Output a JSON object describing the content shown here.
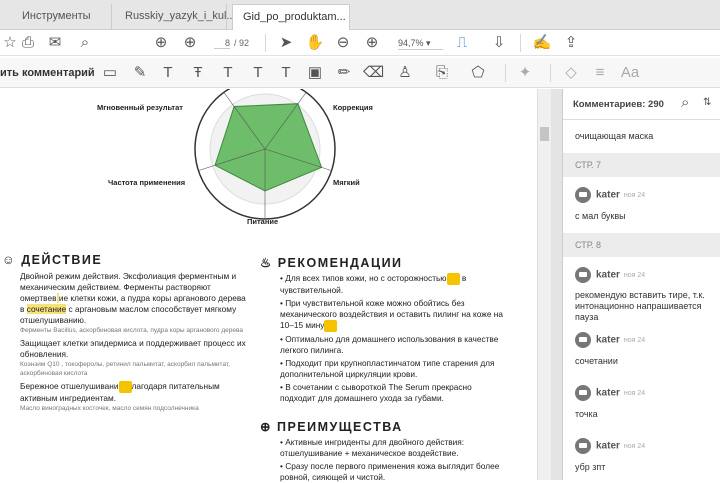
{
  "tabs": [
    {
      "label": "Инструменты"
    },
    {
      "label": "Russkiy_yazyk_i_kul..."
    },
    {
      "label": "Gid_po_produktam...",
      "close": "×"
    }
  ],
  "toolbar": {
    "page_current": "8",
    "page_total": "/ 92",
    "zoom": "94,7%"
  },
  "comment_toolbar": {
    "label": "ить комментарий"
  },
  "chart_data": {
    "type": "radar",
    "axes": [
      "Мгновенный результат",
      "Коррекция",
      "Мягкий",
      "Питание",
      "Частота применения"
    ],
    "values": [
      0.75,
      0.8,
      0.85,
      0.6,
      0.75
    ],
    "fill": "#6dbd6a"
  },
  "doc": {
    "action": {
      "title": "ДЕЙСТВИЕ",
      "p1a": "Двойной режим действия. Эксфолиация ферментным и механическим действием. Ферменты растворяют омертвев",
      "p1b": "ие клетки кожи, а пудра коры арганового дерева в ",
      "p1hl": "сочетание",
      "p1c": " с аргановым маслом способствует мягкому отшелушиванию.",
      "s1": "Ферменты Bacillus, аскорбиновая кислота, пудра коры арганового дерева",
      "p2": "Защищает клетки эпидермиса и поддерживает процесс их обновления.",
      "s2": "Коэнзим Q10 , токоферолы, ретинил пальмитат, аскорбил пальмитат, аскорбиновая кислота",
      "p3a": "Бережное отшелушивани",
      "p3b": "лагодаря питательным активным ингредиентам.",
      "s3": "Масло виноградных косточек, масло семян подсолнечника"
    },
    "recs": {
      "title": "РЕКОМЕНДАЦИИ",
      "items": [
        "Для всех типов кожи, но с осторожностью",
        "в чувствительной.",
        "При чувствительной коже можно обойтись без механического воздействия и оставить пилинг на коже на 10–15 мину",
        "Оптимально для домашнего использования в качестве легкого пилинга.",
        "Подходит при крупнопластинчатом типе старения для дополнительной циркуляции крови.",
        "В сочетании с сывороткой The Serum прекрасно подходит для домашнего ухода за губами."
      ]
    },
    "benefits": {
      "title": "ПРЕИМУЩЕСТВА",
      "items": [
        "Активные ингриденты для двойного действия: отшелушивание + механическое воздействие.",
        "Сразу после первого применения кожа выглядит более ровной, сияющей и чистой."
      ]
    }
  },
  "panel": {
    "title": "Комментариев: 290",
    "top_text": "очищающая маска",
    "page7": "СТР. 7",
    "page8": "СТР. 8",
    "comments": [
      {
        "author": "kater",
        "date": "ноя 24",
        "text": "с мал буквы"
      },
      {
        "author": "kater",
        "date": "ноя 24",
        "text": "рекомендую вставить тире, т.к. интонационно напрашивается пауза"
      },
      {
        "author": "kater",
        "date": "ноя 24",
        "text": "сочетании"
      },
      {
        "author": "kater",
        "date": "ноя 24",
        "text": "точка"
      },
      {
        "author": "kater",
        "date": "ноя 24",
        "text": "убр зпт"
      }
    ]
  }
}
